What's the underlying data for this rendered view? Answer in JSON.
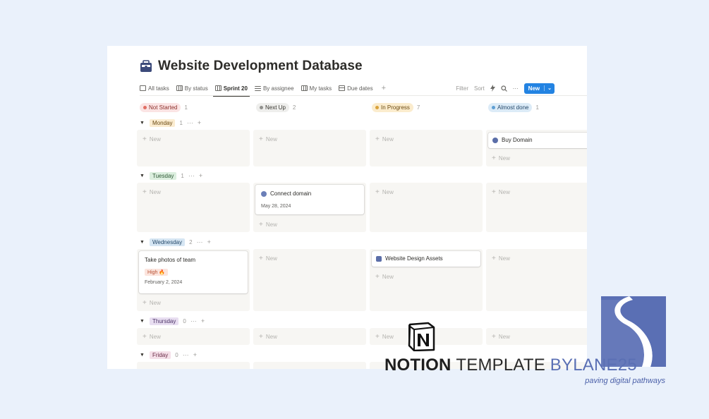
{
  "page": {
    "title": "Website Development Database",
    "icon": "briefcase-icon"
  },
  "views": [
    {
      "label": "All tasks",
      "icon": "table-icon"
    },
    {
      "label": "By status",
      "icon": "board-icon"
    },
    {
      "label": "Sprint 20",
      "icon": "board-icon",
      "active": true
    },
    {
      "label": "By assignee",
      "icon": "list-icon"
    },
    {
      "label": "My tasks",
      "icon": "board-icon"
    },
    {
      "label": "Due dates",
      "icon": "calendar-icon"
    }
  ],
  "toolbar": {
    "filter": "Filter",
    "sort": "Sort",
    "automation_icon": "lightning-icon",
    "search_icon": "search-icon",
    "more": "···",
    "new": "New",
    "new_caret": "⌄"
  },
  "columns": [
    {
      "label": "Not Started",
      "count": "1",
      "bg": "#fbe4e4",
      "dot": "#e16f64"
    },
    {
      "label": "Next Up",
      "count": "2",
      "bg": "#eeeeec",
      "dot": "#91918e"
    },
    {
      "label": "In Progress",
      "count": "7",
      "bg": "#fbeccd",
      "dot": "#d9a23c"
    },
    {
      "label": "Almost done",
      "count": "1",
      "bg": "#dcebf7",
      "dot": "#5e9fd4"
    }
  ],
  "groups": [
    {
      "label": "Monday",
      "count": "1",
      "bg": "#fbecd0",
      "color": "#6b4a12"
    },
    {
      "label": "Tuesday",
      "count": "1",
      "bg": "#dcefdf",
      "color": "#2f5a36"
    },
    {
      "label": "Wednesday",
      "count": "2",
      "bg": "#d6e6f3",
      "color": "#25496a"
    },
    {
      "label": "Thursday",
      "count": "0",
      "bg": "#e8def1",
      "color": "#4d3468"
    },
    {
      "label": "Friday",
      "count": "0",
      "bg": "#f5e0e9",
      "color": "#6b2c48"
    }
  ],
  "group_actions": {
    "more": "···",
    "add": "+"
  },
  "add_new": "New",
  "tasks": {
    "buy_domain": {
      "name": "Buy Domain"
    },
    "connect_domain": {
      "name": "Connect domain",
      "date": "May 28, 2024"
    },
    "take_photos": {
      "name": "Take photos of team",
      "priority": "High 🔥",
      "date": "February 2, 2024"
    },
    "design_assets": {
      "name": "Website Design Assets"
    }
  },
  "brand": {
    "notion": "NOTION",
    "template": "TEMPLATE",
    "by": "BY",
    "lane": "LANE25",
    "tagline": "paving digital pathways"
  }
}
